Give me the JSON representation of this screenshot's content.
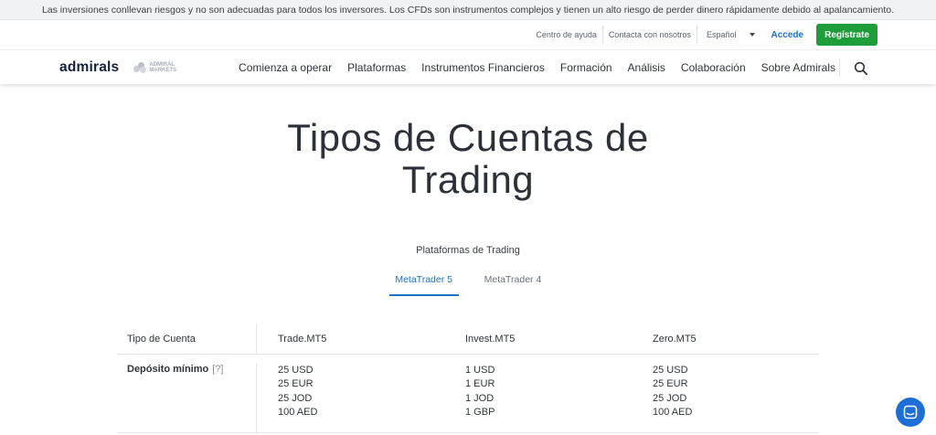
{
  "risk_warning": "Las inversiones conllevan riesgos y no son adecuadas para todos los inversores. Los CFDs son instrumentos complejos y tienen un alto riesgo de perder dinero rápidamente debido al apalancamiento.",
  "utility": {
    "help_center": "Centro de ayuda",
    "contact": "Contacta con nosotros",
    "language": "Español",
    "login": "Accede",
    "register": "Regístrate"
  },
  "brand": {
    "logo": "admirals",
    "sublogo_line1": "ADMIRAL",
    "sublogo_line2": "MARKETS"
  },
  "nav": {
    "items": [
      "Comienza a operar",
      "Plataformas",
      "Instrumentos Financieros",
      "Formación",
      "Análisis",
      "Colaboración",
      "Sobre Admirals"
    ]
  },
  "hero": {
    "title_line1": "Tipos de Cuentas de",
    "title_line2": "Trading"
  },
  "platforms": {
    "label": "Plataformas de Trading",
    "tabs": [
      "MetaTrader 5",
      "MetaTrader 4"
    ],
    "active_tab": "MetaTrader 5"
  },
  "table": {
    "header": [
      "Tipo de Cuenta",
      "Trade.MT5",
      "Invest.MT5",
      "Zero.MT5"
    ],
    "rows": [
      {
        "label": "Depósito mínimo",
        "help": "[?]",
        "trade": [
          "25 USD",
          "25 EUR",
          "25 JOD",
          "100 AED"
        ],
        "invest": [
          "1 USD",
          "1 EUR",
          "1 JOD",
          "1 GBP"
        ],
        "zero": [
          "25 USD",
          "25 EUR",
          "25 JOD",
          "100 AED"
        ]
      }
    ]
  },
  "colors": {
    "accent": "#1a73c9",
    "register_green": "#1f9d3a",
    "brand_navy": "#14213d",
    "chat_blue": "#1d6fd6"
  },
  "icons": {
    "search": "search-icon",
    "language_caret": "chevron-down-icon",
    "chat": "chat-icon"
  }
}
